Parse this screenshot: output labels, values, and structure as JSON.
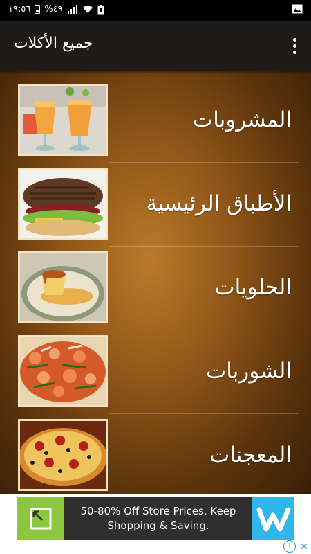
{
  "status_bar": {
    "time": "١٩:٥٦",
    "battery": "%٤٩"
  },
  "app_bar": {
    "title": "جميع الأكلات",
    "menu_icon": "overflow-menu-icon"
  },
  "categories": [
    {
      "label": "المشروبات",
      "image": "juice-glasses"
    },
    {
      "label": "الأطباق الرئيسية",
      "image": "burger"
    },
    {
      "label": "الحلويات",
      "image": "caramel-flan"
    },
    {
      "label": "الشوربات",
      "image": "seafood-dish"
    },
    {
      "label": "المعجنات",
      "image": "pizza"
    }
  ],
  "ad": {
    "text": "50-80% Off Store Prices. Keep Shopping & Saving.",
    "info_icon": "i",
    "close_icon": "✕",
    "colors": {
      "left_tile": "#8dc63f",
      "logo_tile": "#2fb7ec",
      "banner": "#2f2f2f"
    }
  },
  "colors": {
    "app_bar": "#1e1b18",
    "background_center": "#b97a2a",
    "background_edge": "#3a1f06"
  }
}
